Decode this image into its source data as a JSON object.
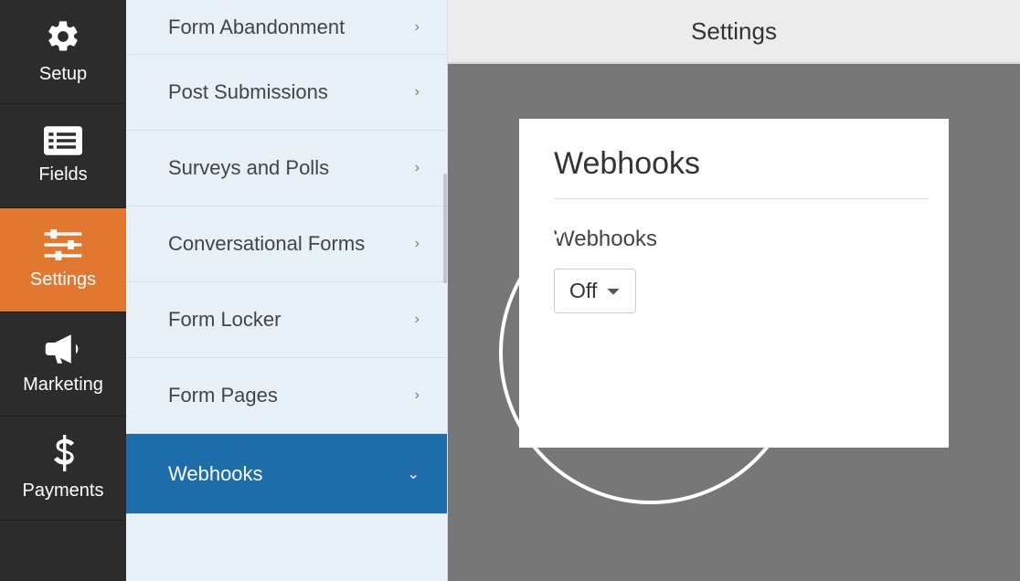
{
  "nav": {
    "items": [
      {
        "label": "Setup"
      },
      {
        "label": "Fields"
      },
      {
        "label": "Settings"
      },
      {
        "label": "Marketing"
      },
      {
        "label": "Payments"
      }
    ],
    "active_index": 2
  },
  "submenu": {
    "items": [
      {
        "label": "Form Abandonment",
        "expanded": false
      },
      {
        "label": "Post Submissions",
        "expanded": false
      },
      {
        "label": "Surveys and Polls",
        "expanded": false
      },
      {
        "label": "Conversational Forms",
        "expanded": false
      },
      {
        "label": "Form Locker",
        "expanded": false
      },
      {
        "label": "Form Pages",
        "expanded": false
      },
      {
        "label": "Webhooks",
        "expanded": true
      }
    ],
    "active_index": 6
  },
  "header": {
    "title": "Settings"
  },
  "panel": {
    "title": "Webhooks",
    "field_label": "Webhooks",
    "dropdown_value": "Off"
  }
}
